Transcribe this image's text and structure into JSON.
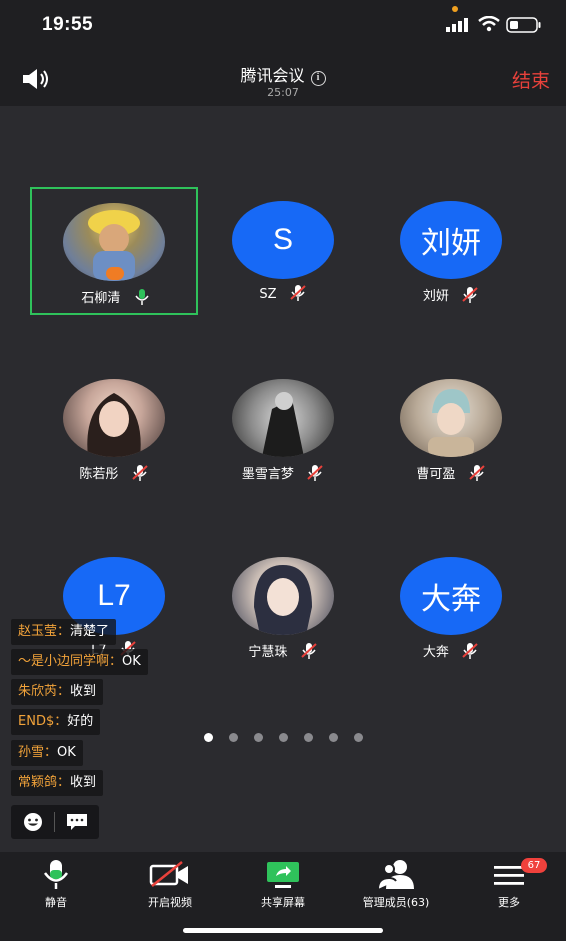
{
  "status_bar": {
    "time": "19:55"
  },
  "header": {
    "title": "腾讯会议",
    "timer": "25:07",
    "end_label": "结束"
  },
  "participants": [
    {
      "name": "石柳清",
      "avatar_type": "photo",
      "mic": "on",
      "active_speaker": true,
      "host": true
    },
    {
      "name": "SZ",
      "avatar_type": "text",
      "avatar_text": "S",
      "mic": "muted"
    },
    {
      "name": "刘妍",
      "avatar_type": "text",
      "avatar_text": "刘妍",
      "mic": "muted"
    },
    {
      "name": "陈若彤",
      "avatar_type": "photo",
      "mic": "muted"
    },
    {
      "name": "墨雪言梦",
      "avatar_type": "photo",
      "mic": "muted"
    },
    {
      "name": "曹可盈",
      "avatar_type": "photo",
      "mic": "muted"
    },
    {
      "name": "L7",
      "avatar_type": "text",
      "avatar_text": "L7",
      "mic": "muted"
    },
    {
      "name": "宁慧珠",
      "avatar_type": "photo",
      "mic": "muted"
    },
    {
      "name": "大奔",
      "avatar_type": "text",
      "avatar_text": "大奔",
      "mic": "muted"
    }
  ],
  "pager": {
    "pages": 7,
    "current": 1
  },
  "chat": [
    {
      "sender": "赵玉莹：",
      "text": "清楚了"
    },
    {
      "sender": "～是小边同学啊：",
      "text": "OK"
    },
    {
      "sender": "朱欣芮：",
      "text": "收到"
    },
    {
      "sender": "END$：",
      "text": "好的"
    },
    {
      "sender": "孙雪：",
      "text": "OK"
    },
    {
      "sender": "常颖鸽：",
      "text": "收到"
    }
  ],
  "toolbar": {
    "mute_label": "静音",
    "video_label": "开启视频",
    "share_label": "共享屏幕",
    "members_label": "管理成员(63)",
    "more_label": "更多",
    "more_badge": "67"
  },
  "colors": {
    "accent": "#1769f6",
    "end": "#e8413b",
    "active_border": "#2fc25b",
    "chat_sender": "#f2a33a",
    "badge": "#f0413c"
  },
  "icons": [
    "speaker-icon",
    "info-icon",
    "mic-icon",
    "mic-muted-icon",
    "host-icon",
    "emoji-icon",
    "chat-icon",
    "video-off-icon",
    "share-screen-icon",
    "members-icon",
    "menu-icon"
  ]
}
